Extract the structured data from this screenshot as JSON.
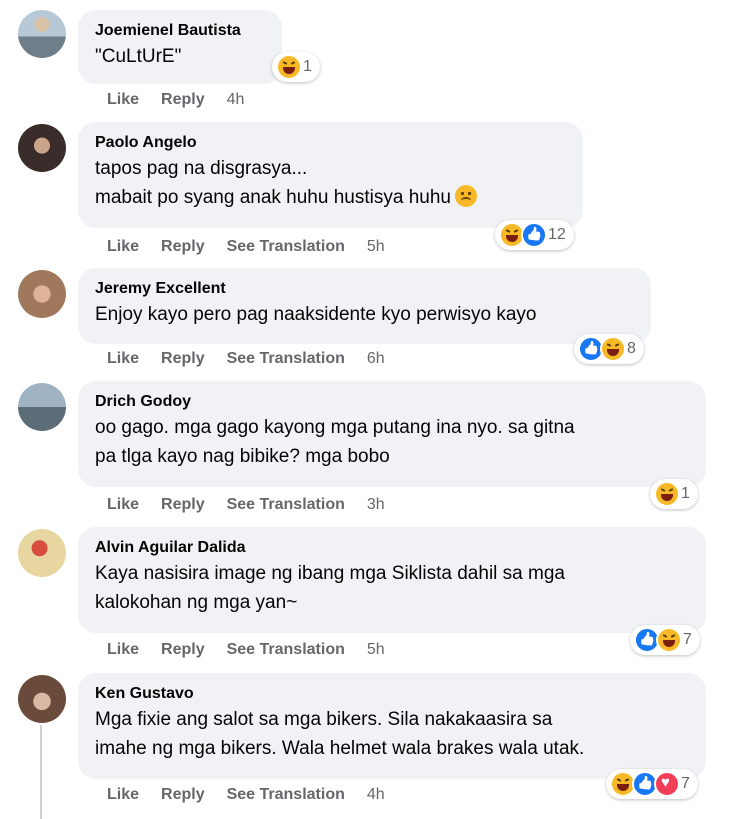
{
  "actions": {
    "like": "Like",
    "reply": "Reply",
    "see_translation": "See Translation"
  },
  "comments": [
    {
      "author": "Joemienel Bautista",
      "lines": "\"CuLtUrE\"",
      "time": "4h",
      "reactions": [
        "haha-icon"
      ],
      "count": "1",
      "translate": false
    },
    {
      "author": "Paolo Angelo",
      "lines": "tapos pag na disgrasya...\nmabait po syang anak huhu hustisya huhu",
      "time": "5h",
      "reactions": [
        "haha-icon",
        "like-icon"
      ],
      "count": "12",
      "translate": true,
      "inline_emoji": "sad-face-emoji"
    },
    {
      "author": "Jeremy Excellent",
      "lines": "Enjoy kayo pero pag naaksidente kyo perwisyo kayo",
      "time": "6h",
      "reactions": [
        "like-icon",
        "haha-icon"
      ],
      "count": "8",
      "translate": true
    },
    {
      "author": "Drich Godoy",
      "lines": "oo gago. mga gago kayong mga putang ina nyo. sa gitna\npa tlga kayo nag bibike? mga bobo",
      "time": "3h",
      "reactions": [
        "haha-icon"
      ],
      "count": "1",
      "translate": true
    },
    {
      "author": "Alvin Aguilar Dalida",
      "lines": "Kaya nasisira image ng ibang mga Siklista dahil sa mga\nkalokohan ng mga yan~",
      "time": "5h",
      "reactions": [
        "like-icon",
        "haha-icon"
      ],
      "count": "7",
      "translate": true
    },
    {
      "author": "Ken Gustavo",
      "lines": "Mga fixie ang salot sa mga bikers. Sila nakakaasira sa\nimahe ng mga bikers. Wala helmet wala brakes wala utak.",
      "time": "4h",
      "reactions": [
        "haha-icon",
        "like-icon",
        "love-icon"
      ],
      "count": "7",
      "translate": true
    }
  ],
  "colors": {
    "bubble": "#f0f2f5",
    "meta": "#65676b",
    "like_blue": "#1877f2",
    "haha_yellow": "#f7b928",
    "love_red": "#f33e58"
  }
}
